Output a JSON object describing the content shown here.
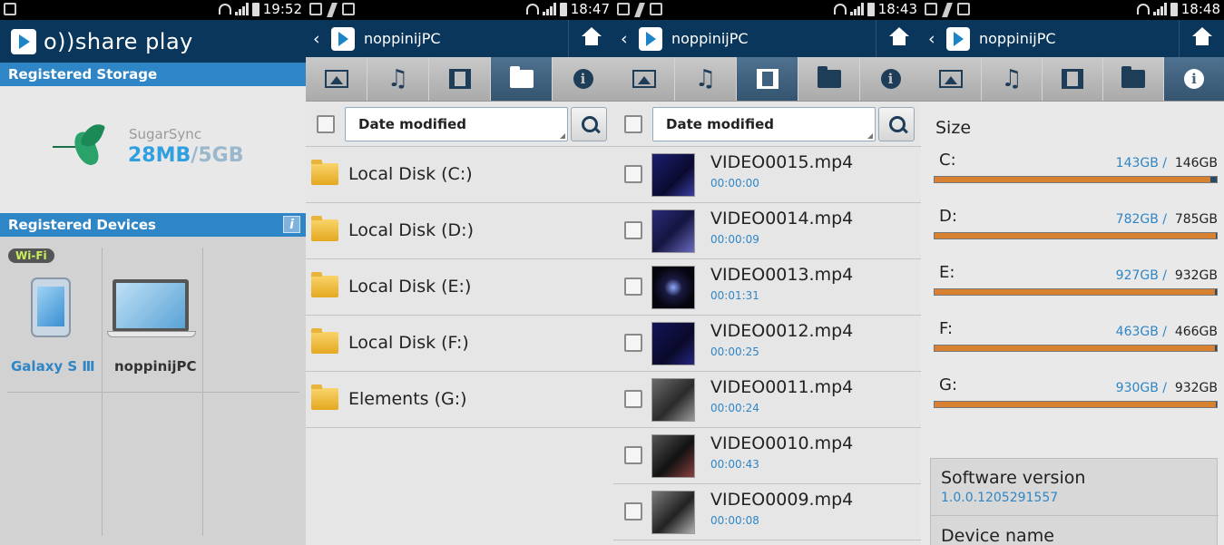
{
  "s1": {
    "time": "19:52",
    "app_name": "o))share play",
    "registered_storage": "Registered Storage",
    "storage_name": "SugarSync",
    "storage_used": "28MB",
    "storage_sep": "/",
    "storage_total": "5GB",
    "registered_devices": "Registered Devices",
    "info_label": "i",
    "wifi_badge": "Wi-Fi",
    "device1": "Galaxy S Ⅲ",
    "device2": "noppinijPC"
  },
  "s2": {
    "time": "18:47",
    "title": "noppinijPC",
    "sort": "Date modified",
    "folders": [
      "Local Disk (C:)",
      "Local Disk (D:)",
      "Local Disk (E:)",
      "Local Disk (F:)",
      "Elements (G:)"
    ]
  },
  "s3": {
    "time": "18:43",
    "title": "noppinijPC",
    "sort": "Date modified",
    "videos": [
      {
        "name": "VIDEO0015.mp4",
        "duration": "00:00:00"
      },
      {
        "name": "VIDEO0014.mp4",
        "duration": "00:00:09"
      },
      {
        "name": "VIDEO0013.mp4",
        "duration": "00:01:31"
      },
      {
        "name": "VIDEO0012.mp4",
        "duration": "00:00:25"
      },
      {
        "name": "VIDEO0011.mp4",
        "duration": "00:00:24"
      },
      {
        "name": "VIDEO0010.mp4",
        "duration": "00:00:43"
      },
      {
        "name": "VIDEO0009.mp4",
        "duration": "00:00:08"
      }
    ]
  },
  "s4": {
    "time": "18:48",
    "title": "noppinijPC",
    "size_heading": "Size",
    "drives": [
      {
        "label": "C:",
        "used": "143GB /",
        "total": "146GB",
        "fill": 0.979
      },
      {
        "label": "D:",
        "used": "782GB /",
        "total": "785GB",
        "fill": 0.996
      },
      {
        "label": "E:",
        "used": "927GB /",
        "total": "932GB",
        "fill": 0.995
      },
      {
        "label": "F:",
        "used": "463GB /",
        "total": "466GB",
        "fill": 0.994
      },
      {
        "label": "G:",
        "used": "930GB /",
        "total": "932GB",
        "fill": 0.998
      }
    ],
    "software_version_label": "Software version",
    "software_version": "1.0.0.1205291557",
    "device_name_label": "Device name"
  },
  "colors": {
    "header": "#09365a",
    "section": "#2f86c6",
    "accent_blue": "#2f86c6",
    "bar_fill": "#d78131"
  }
}
